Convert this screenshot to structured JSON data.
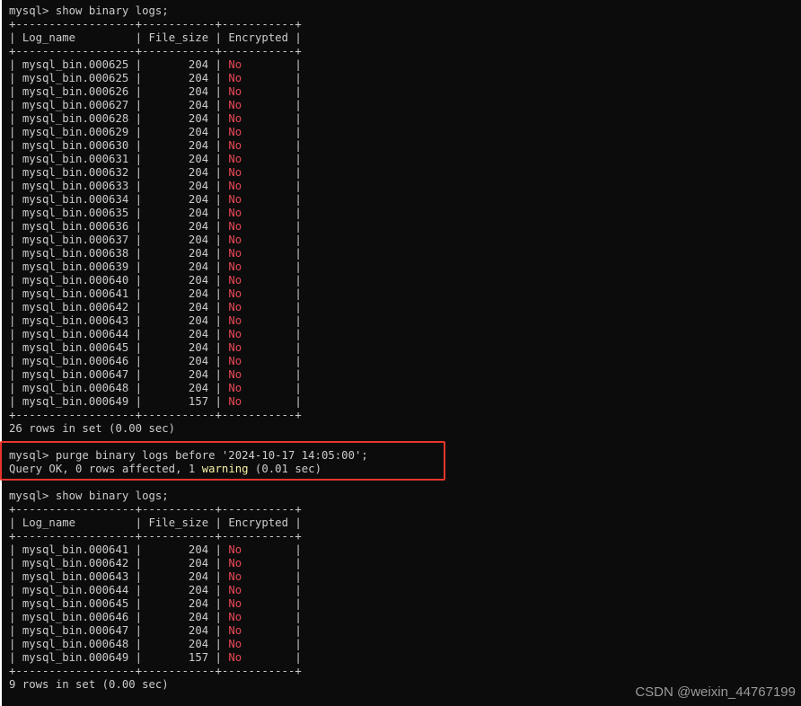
{
  "lines": [
    {
      "type": "text",
      "text": "mysql> show binary logs;"
    },
    {
      "type": "text",
      "text": "+------------------+-----------+-----------+"
    },
    {
      "type": "header",
      "log_name": "Log_name",
      "file_size": "File_size",
      "encrypted": "Encrypted"
    },
    {
      "type": "text",
      "text": "+------------------+-----------+-----------+"
    },
    {
      "type": "row",
      "log_name": "mysql_bin.000625",
      "file_size": "204",
      "encrypted": "No"
    },
    {
      "type": "row",
      "log_name": "mysql_bin.000625",
      "file_size": "204",
      "encrypted": "No"
    },
    {
      "type": "row",
      "log_name": "mysql_bin.000626",
      "file_size": "204",
      "encrypted": "No"
    },
    {
      "type": "row",
      "log_name": "mysql_bin.000627",
      "file_size": "204",
      "encrypted": "No"
    },
    {
      "type": "row",
      "log_name": "mysql_bin.000628",
      "file_size": "204",
      "encrypted": "No"
    },
    {
      "type": "row",
      "log_name": "mysql_bin.000629",
      "file_size": "204",
      "encrypted": "No"
    },
    {
      "type": "row",
      "log_name": "mysql_bin.000630",
      "file_size": "204",
      "encrypted": "No"
    },
    {
      "type": "row",
      "log_name": "mysql_bin.000631",
      "file_size": "204",
      "encrypted": "No"
    },
    {
      "type": "row",
      "log_name": "mysql_bin.000632",
      "file_size": "204",
      "encrypted": "No"
    },
    {
      "type": "row",
      "log_name": "mysql_bin.000633",
      "file_size": "204",
      "encrypted": "No"
    },
    {
      "type": "row",
      "log_name": "mysql_bin.000634",
      "file_size": "204",
      "encrypted": "No"
    },
    {
      "type": "row",
      "log_name": "mysql_bin.000635",
      "file_size": "204",
      "encrypted": "No"
    },
    {
      "type": "row",
      "log_name": "mysql_bin.000636",
      "file_size": "204",
      "encrypted": "No"
    },
    {
      "type": "row",
      "log_name": "mysql_bin.000637",
      "file_size": "204",
      "encrypted": "No"
    },
    {
      "type": "row",
      "log_name": "mysql_bin.000638",
      "file_size": "204",
      "encrypted": "No"
    },
    {
      "type": "row",
      "log_name": "mysql_bin.000639",
      "file_size": "204",
      "encrypted": "No"
    },
    {
      "type": "row",
      "log_name": "mysql_bin.000640",
      "file_size": "204",
      "encrypted": "No"
    },
    {
      "type": "row",
      "log_name": "mysql_bin.000641",
      "file_size": "204",
      "encrypted": "No"
    },
    {
      "type": "row",
      "log_name": "mysql_bin.000642",
      "file_size": "204",
      "encrypted": "No"
    },
    {
      "type": "row",
      "log_name": "mysql_bin.000643",
      "file_size": "204",
      "encrypted": "No"
    },
    {
      "type": "row",
      "log_name": "mysql_bin.000644",
      "file_size": "204",
      "encrypted": "No"
    },
    {
      "type": "row",
      "log_name": "mysql_bin.000645",
      "file_size": "204",
      "encrypted": "No"
    },
    {
      "type": "row",
      "log_name": "mysql_bin.000646",
      "file_size": "204",
      "encrypted": "No"
    },
    {
      "type": "row",
      "log_name": "mysql_bin.000647",
      "file_size": "204",
      "encrypted": "No"
    },
    {
      "type": "row",
      "log_name": "mysql_bin.000648",
      "file_size": "204",
      "encrypted": "No"
    },
    {
      "type": "row",
      "log_name": "mysql_bin.000649",
      "file_size": "157",
      "encrypted": "No"
    },
    {
      "type": "text",
      "text": "+------------------+-----------+-----------+"
    },
    {
      "type": "text",
      "text": "26 rows in set (0.00 sec)"
    },
    {
      "type": "text",
      "text": ""
    },
    {
      "type": "text",
      "text": "mysql> purge binary logs before '2024-10-17 14:05:00';"
    },
    {
      "type": "warning",
      "before": "Query OK, 0 rows affected, 1 ",
      "highlight": "warning",
      "after": " (0.01 sec)"
    },
    {
      "type": "text",
      "text": ""
    },
    {
      "type": "text",
      "text": "mysql> show binary logs;"
    },
    {
      "type": "text",
      "text": "+------------------+-----------+-----------+"
    },
    {
      "type": "header",
      "log_name": "Log_name",
      "file_size": "File_size",
      "encrypted": "Encrypted"
    },
    {
      "type": "text",
      "text": "+------------------+-----------+-----------+"
    },
    {
      "type": "row",
      "log_name": "mysql_bin.000641",
      "file_size": "204",
      "encrypted": "No"
    },
    {
      "type": "row",
      "log_name": "mysql_bin.000642",
      "file_size": "204",
      "encrypted": "No"
    },
    {
      "type": "row",
      "log_name": "mysql_bin.000643",
      "file_size": "204",
      "encrypted": "No"
    },
    {
      "type": "row",
      "log_name": "mysql_bin.000644",
      "file_size": "204",
      "encrypted": "No"
    },
    {
      "type": "row",
      "log_name": "mysql_bin.000645",
      "file_size": "204",
      "encrypted": "No"
    },
    {
      "type": "row",
      "log_name": "mysql_bin.000646",
      "file_size": "204",
      "encrypted": "No"
    },
    {
      "type": "row",
      "log_name": "mysql_bin.000647",
      "file_size": "204",
      "encrypted": "No"
    },
    {
      "type": "row",
      "log_name": "mysql_bin.000648",
      "file_size": "204",
      "encrypted": "No"
    },
    {
      "type": "row",
      "log_name": "mysql_bin.000649",
      "file_size": "157",
      "encrypted": "No"
    },
    {
      "type": "text",
      "text": "+------------------+-----------+-----------+"
    },
    {
      "type": "text",
      "text": "9 rows in set (0.00 sec)"
    }
  ],
  "watermark": "CSDN @weixin_44767199",
  "colors": {
    "background": "#0c0c0c",
    "text": "#cccccc",
    "no_value": "#e74856",
    "warning": "#f9f1a5",
    "highlight_border": "#e8352c"
  }
}
